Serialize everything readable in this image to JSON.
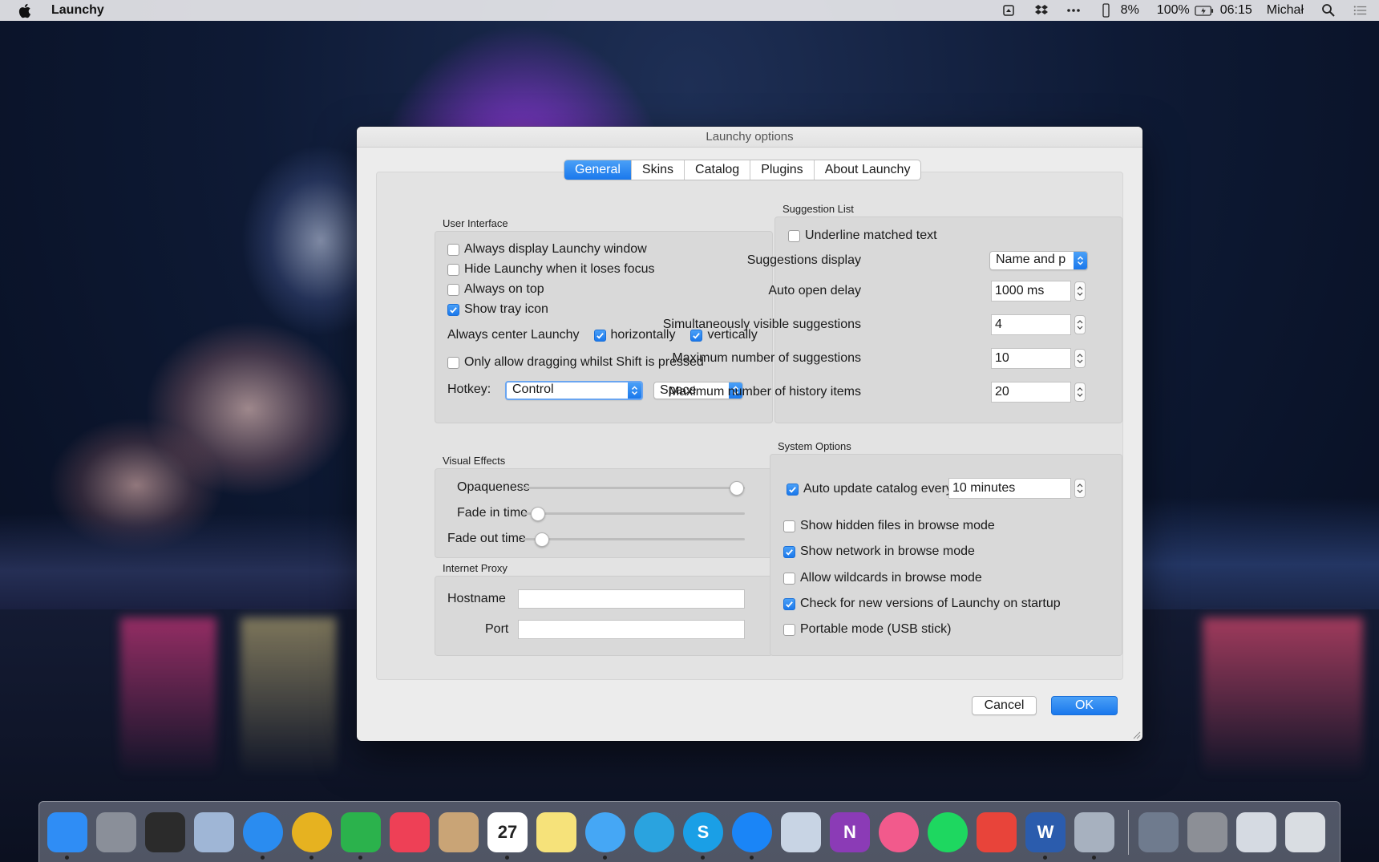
{
  "menubar": {
    "app_name": "Launchy",
    "battery_small": "8%",
    "battery": "100%",
    "time": "06:15",
    "user": "Michał"
  },
  "window": {
    "title": "Launchy options"
  },
  "tabs": [
    "General",
    "Skins",
    "Catalog",
    "Plugins",
    "About Launchy"
  ],
  "active_tab": "General",
  "user_interface": {
    "label": "User Interface",
    "always_display": {
      "label": "Always display Launchy window",
      "checked": false
    },
    "hide_on_focus": {
      "label": "Hide Launchy when it loses focus",
      "checked": false
    },
    "always_on_top": {
      "label": "Always on top",
      "checked": false
    },
    "show_tray": {
      "label": "Show tray icon",
      "checked": true
    },
    "center_label": "Always center Launchy",
    "horizontally": {
      "label": "horizontally",
      "checked": true
    },
    "vertically": {
      "label": "vertically",
      "checked": true
    },
    "drag_shift": {
      "label": "Only allow dragging whilst Shift is pressed",
      "checked": false
    },
    "hotkey_label": "Hotkey:",
    "hotkey_modifier": "Control",
    "hotkey_key": "Space"
  },
  "suggestion_list": {
    "label": "Suggestion List",
    "underline": {
      "label": "Underline matched text",
      "checked": false
    },
    "display_label": "Suggestions display",
    "display_value": "Name and p",
    "auto_open_label": "Auto open delay",
    "auto_open_value": "1000 ms",
    "visible_label": "Simultaneously visible suggestions",
    "visible_value": "4",
    "max_label": "Maximum number of suggestions",
    "max_value": "10",
    "history_label": "Maximum number of history items",
    "history_value": "20"
  },
  "visual_effects": {
    "label": "Visual Effects",
    "opaqueness_label": "Opaqueness",
    "opaqueness": 1.0,
    "fade_in_label": "Fade in time",
    "fade_in": 0.04,
    "fade_out_label": "Fade out time",
    "fade_out": 0.06
  },
  "internet_proxy": {
    "label": "Internet Proxy",
    "hostname_label": "Hostname",
    "hostname": "",
    "port_label": "Port",
    "port": ""
  },
  "system_options": {
    "label": "System Options",
    "auto_update": {
      "label": "Auto update catalog every",
      "checked": true
    },
    "auto_update_value": "10 minutes",
    "hidden_files": {
      "label": "Show hidden files in browse mode",
      "checked": false
    },
    "network": {
      "label": "Show network in browse mode",
      "checked": true
    },
    "wildcards": {
      "label": "Allow wildcards in browse mode",
      "checked": false
    },
    "check_versions": {
      "label": "Check for new versions of Launchy on startup",
      "checked": true
    },
    "portable": {
      "label": "Portable mode (USB stick)",
      "checked": false
    }
  },
  "buttons": {
    "cancel": "Cancel",
    "ok": "OK"
  },
  "dock": {
    "items": [
      {
        "name": "finder-icon",
        "color": "#2f8df5",
        "glyph": ""
      },
      {
        "name": "launchpad-icon",
        "color": "#8a8f99",
        "glyph": ""
      },
      {
        "name": "activity-monitor-icon",
        "color": "#2b2b2b",
        "glyph": ""
      },
      {
        "name": "mail-icon",
        "color": "#9fb6d6",
        "glyph": ""
      },
      {
        "name": "safari-icon",
        "color": "#2a8cf0",
        "glyph": ""
      },
      {
        "name": "chrome-icon",
        "color": "#e6b220",
        "glyph": ""
      },
      {
        "name": "feedly-icon",
        "color": "#2bb24c",
        "glyph": ""
      },
      {
        "name": "pocket-icon",
        "color": "#ee4056",
        "glyph": ""
      },
      {
        "name": "contacts-icon",
        "color": "#c9a476",
        "glyph": ""
      },
      {
        "name": "calendar-icon",
        "color": "#ffffff",
        "glyph": "27"
      },
      {
        "name": "notes-icon",
        "color": "#f6e27a",
        "glyph": ""
      },
      {
        "name": "messages-icon",
        "color": "#45a7f5",
        "glyph": ""
      },
      {
        "name": "telegram-icon",
        "color": "#2aa3df",
        "glyph": ""
      },
      {
        "name": "skype-icon",
        "color": "#1a9fe6",
        "glyph": "S"
      },
      {
        "name": "messenger-icon",
        "color": "#1a85f7",
        "glyph": ""
      },
      {
        "name": "preview-icon",
        "color": "#c8d4e4",
        "glyph": ""
      },
      {
        "name": "onenote-icon",
        "color": "#8b3bb6",
        "glyph": "N"
      },
      {
        "name": "itunes-icon",
        "color": "#f25a8c",
        "glyph": ""
      },
      {
        "name": "spotify-icon",
        "color": "#1ed760",
        "glyph": ""
      },
      {
        "name": "transmit-icon",
        "color": "#e8443a",
        "glyph": ""
      },
      {
        "name": "word-icon",
        "color": "#2b5cad",
        "glyph": "W"
      },
      {
        "name": "launchy-icon",
        "color": "#a7b1bf",
        "glyph": ""
      }
    ],
    "right_items": [
      {
        "name": "downloads-stack-icon",
        "color": "#6f7b8e"
      },
      {
        "name": "documents-stack-icon",
        "color": "#8c8f96"
      },
      {
        "name": "recent-doc-icon",
        "color": "#d5dae2"
      },
      {
        "name": "trash-icon",
        "color": "#d9dde2"
      }
    ]
  }
}
